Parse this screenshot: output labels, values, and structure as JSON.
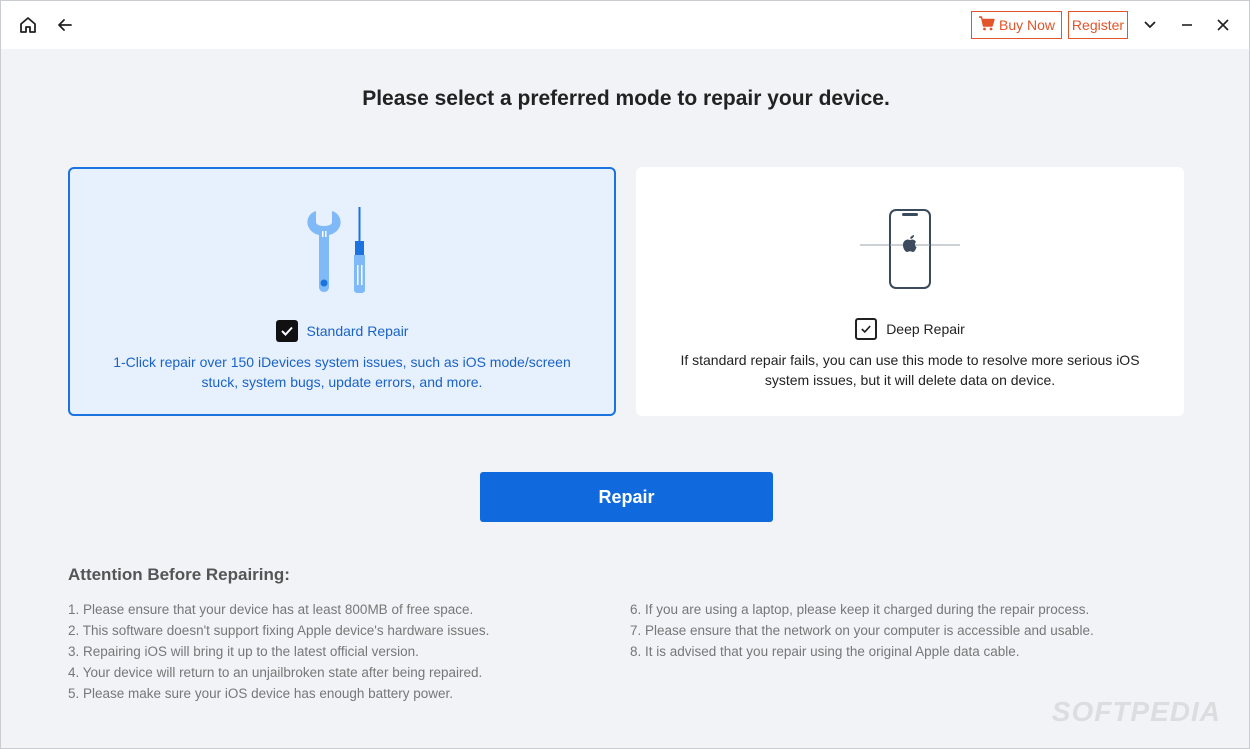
{
  "titlebar": {
    "buy_label": "Buy Now",
    "register_label": "Register"
  },
  "page": {
    "title": "Please select a preferred mode to repair your device."
  },
  "modes": [
    {
      "label": "Standard Repair",
      "description_line1": "1-Click repair over 150 iDevices system issues, such as iOS mode/screen",
      "description_line2": "stuck, system bugs, update errors, and more.",
      "selected": true,
      "icon": "wrench-screwdriver-icon"
    },
    {
      "label": "Deep Repair",
      "description_line1": "If standard repair fails, you can use this mode to resolve more serious iOS",
      "description_line2": "system issues, but it will delete data on device.",
      "selected": false,
      "icon": "iphone-icon"
    }
  ],
  "repair_button": "Repair",
  "attention": {
    "title": "Attention Before Repairing:",
    "left": [
      "1. Please ensure that your device has at least 800MB of free space.",
      "2. This software doesn't support fixing Apple device's hardware issues.",
      "3. Repairing iOS will bring it up to the latest official version.",
      "4. Your device will return to an unjailbroken state after being repaired.",
      "5. Please make sure your iOS device has enough battery power."
    ],
    "right": [
      "6. If you are using a laptop, please keep it charged during the repair process.",
      "7. Please ensure that the network on your computer is accessible and usable.",
      "8. It is advised that you repair using the original Apple data cable."
    ]
  },
  "watermark": "SOFTPEDIA",
  "colors": {
    "accent": "#1069dd",
    "selected_card_bg": "#e7f1fd",
    "buy_accent": "#e2552a"
  }
}
